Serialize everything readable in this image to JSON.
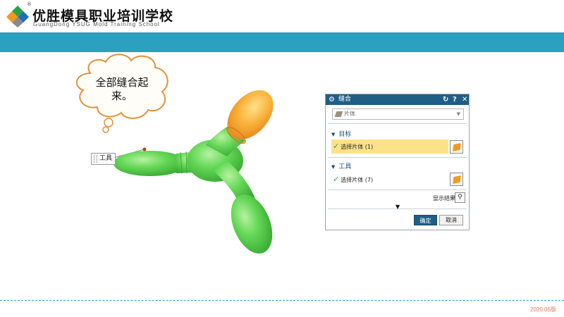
{
  "header": {
    "school_name": "优胜模具职业培训学校",
    "school_en": "GuangDong YSUG Mold Training School",
    "reg_mark": "®"
  },
  "scene": {
    "bubble_text": "全部缝合起来。",
    "tool_label": "工具",
    "colors": {
      "green": "#5fd452",
      "orange": "#f7a531"
    }
  },
  "dialog": {
    "title": "缝合",
    "controls": {
      "reset": "↻",
      "help": "?",
      "close": "✕"
    },
    "type_dropdown": {
      "value": "片体"
    },
    "target_section": {
      "label": "目标",
      "select_label": "选择片体 (1)"
    },
    "tool_section": {
      "label": "工具",
      "select_label": "选择片体 (7)"
    },
    "show_result_label": "显示结果",
    "ok_label": "确定",
    "cancel_label": "取消",
    "colors": {
      "title_bar": "#1f5f86",
      "highlight": "#fde28a"
    }
  },
  "footer": {
    "version": "2020.05版"
  },
  "colors": {
    "teal_bar": "#2ba0bf"
  }
}
